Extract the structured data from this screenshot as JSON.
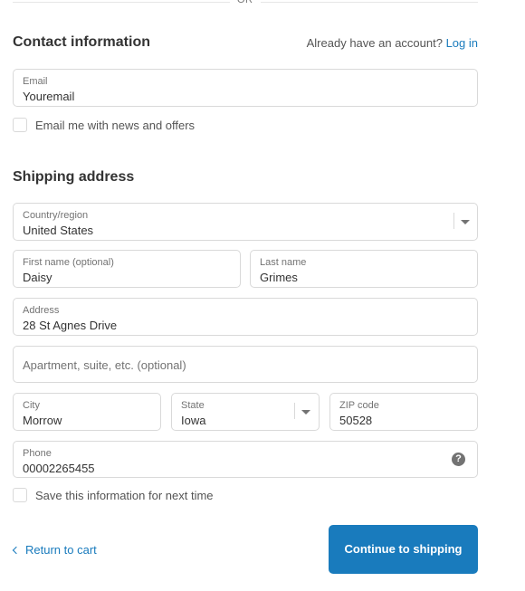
{
  "divider": {
    "label": "OR"
  },
  "contact": {
    "title": "Contact information",
    "login_prompt": "Already have an account?",
    "login_link": "Log in",
    "email": {
      "label": "Email",
      "value": "Youremail"
    },
    "newsletter_label": "Email me with news and offers"
  },
  "shipping": {
    "title": "Shipping address",
    "country": {
      "label": "Country/region",
      "value": "United States"
    },
    "first_name": {
      "label": "First name (optional)",
      "value": "Daisy"
    },
    "last_name": {
      "label": "Last name",
      "value": "Grimes"
    },
    "address": {
      "label": "Address",
      "value": "28 St Agnes Drive"
    },
    "apartment": {
      "placeholder": "Apartment, suite, etc. (optional)"
    },
    "city": {
      "label": "City",
      "value": "Morrow"
    },
    "state": {
      "label": "State",
      "value": "Iowa"
    },
    "zip": {
      "label": "ZIP code",
      "value": "50528"
    },
    "phone": {
      "label": "Phone",
      "value": "00002265455",
      "help_icon": "?"
    },
    "save_info_label": "Save this information for next time"
  },
  "footer": {
    "return_label": "Return to cart",
    "continue_label": "Continue to shipping"
  },
  "colors": {
    "accent": "#197bbd",
    "border": "#d9d9d9",
    "muted": "#737373"
  }
}
